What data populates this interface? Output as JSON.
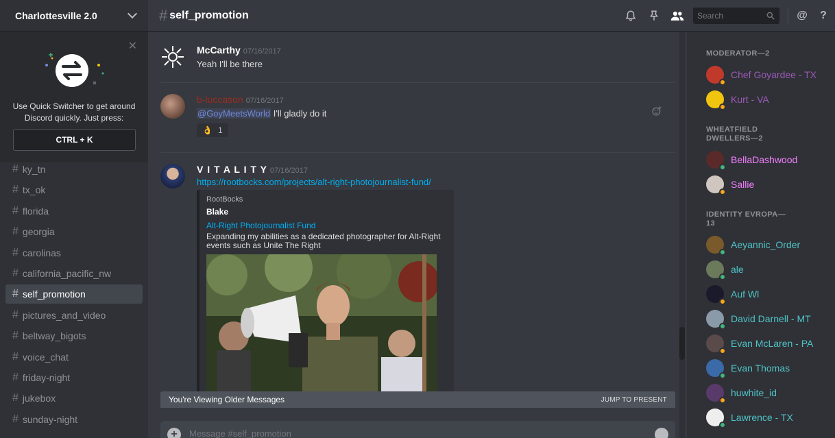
{
  "server": {
    "name": "Charlottesville 2.0"
  },
  "quick_switcher": {
    "text_line1": "Use Quick Switcher to get around",
    "text_line2": "Discord quickly. Just press:",
    "shortcut": "CTRL + K"
  },
  "channels": [
    {
      "name": "ky_tn",
      "active": false
    },
    {
      "name": "tx_ok",
      "active": false
    },
    {
      "name": "florida",
      "active": false
    },
    {
      "name": "georgia",
      "active": false
    },
    {
      "name": "carolinas",
      "active": false
    },
    {
      "name": "california_pacific_nw",
      "active": false
    },
    {
      "name": "self_promotion",
      "active": true
    },
    {
      "name": "pictures_and_video",
      "active": false
    },
    {
      "name": "beltway_bigots",
      "active": false
    },
    {
      "name": "voice_chat",
      "active": false
    },
    {
      "name": "friday-night",
      "active": false
    },
    {
      "name": "jukebox",
      "active": false
    },
    {
      "name": "sunday-night",
      "active": false
    }
  ],
  "header": {
    "channel": "self_promotion",
    "search_placeholder": "Search"
  },
  "messages": [
    {
      "author": "McCarthy",
      "author_color": "#ffffff",
      "timestamp": "07/16/2017",
      "text": "Yeah I'll be there"
    },
    {
      "author": "b-luccason",
      "author_color": "#992d22",
      "timestamp": "07/16/2017",
      "mention": "@GoyMeetsWorld",
      "text": " I'll gladly do it",
      "reaction_emoji": "👌",
      "reaction_count": "1"
    },
    {
      "author": "V I T A L I T Y",
      "author_color": "#ffffff",
      "timestamp": "07/16/2017",
      "link": "https://rootbocks.com/projects/alt-right-photojournalist-fund/",
      "embed": {
        "provider": "RootBocks",
        "author": "Blake",
        "title": "Alt-Right Photojournalist Fund",
        "description": "Expanding my abilities as a dedicated photographer for Alt-Right events such as Unite The Right"
      }
    }
  ],
  "older_bar": {
    "label": "You're Viewing Older Messages",
    "jump": "JUMP TO PRESENT"
  },
  "input": {
    "placeholder": "Message #self_promotion"
  },
  "members": {
    "roles": [
      {
        "title": "MODERATOR—2",
        "members": [
          {
            "name": "Chef Goyardee - TX",
            "color": "#9b59b6",
            "status": "#faa61a",
            "avatar": "#c0392b"
          },
          {
            "name": "Kurt - VA",
            "color": "#9b59b6",
            "status": "#faa61a",
            "avatar": "#f1c40f"
          }
        ]
      },
      {
        "title": "WHEATFIELD DWELLERS—2",
        "members": [
          {
            "name": "BellaDashwood",
            "color": "#f47fff",
            "status": "#43b581",
            "avatar": "#5a2a2a"
          },
          {
            "name": "Sallie",
            "color": "#f47fff",
            "status": "#faa61a",
            "avatar": "#cfc7bf"
          }
        ]
      },
      {
        "title": "IDENTITY EVROPA—13",
        "members": [
          {
            "name": "Aeyannic_Order",
            "color": "#4fc3c6",
            "status": "#43b581",
            "avatar": "#7a5a2a"
          },
          {
            "name": "ale",
            "color": "#4fc3c6",
            "status": "#43b581",
            "avatar": "#6b7a5a"
          },
          {
            "name": "Auf Wl",
            "color": "#4fc3c6",
            "status": "#faa61a",
            "avatar": "#1a1a2a"
          },
          {
            "name": "David Darnell - MT",
            "color": "#4fc3c6",
            "status": "#43b581",
            "avatar": "#8a9aa8"
          },
          {
            "name": "Evan McLaren - PA",
            "color": "#4fc3c6",
            "status": "#faa61a",
            "avatar": "#5a4a4a"
          },
          {
            "name": "Evan Thomas",
            "color": "#4fc3c6",
            "status": "#43b581",
            "avatar": "#3a6aa8"
          },
          {
            "name": "huwhite_id",
            "color": "#4fc3c6",
            "status": "#faa61a",
            "avatar": "#5a3a6a"
          },
          {
            "name": "Lawrence - TX",
            "color": "#4fc3c6",
            "status": "#43b581",
            "avatar": "#eeeeee"
          }
        ]
      }
    ]
  }
}
